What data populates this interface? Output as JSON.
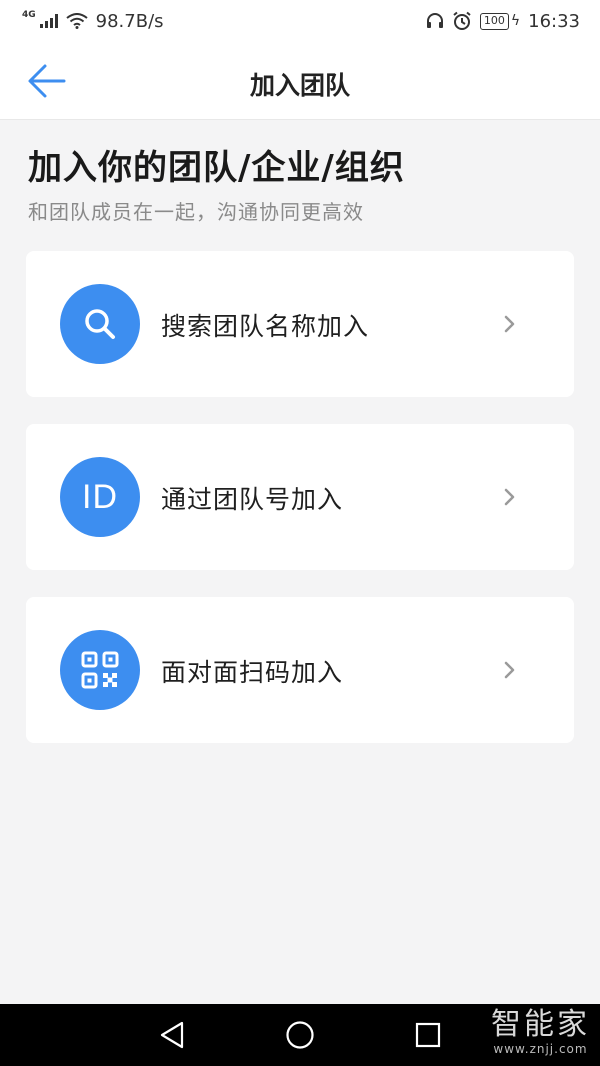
{
  "status_bar": {
    "network": "4G",
    "speed": "98.7B/s",
    "battery": "100",
    "time": "16:33"
  },
  "header": {
    "title": "加入团队",
    "back_icon": "arrow-left-icon"
  },
  "intro": {
    "heading": "加入你的团队/企业/组织",
    "subtitle": "和团队成员在一起，沟通协同更高效"
  },
  "options": [
    {
      "label": "搜索团队名称加入",
      "icon": "search-icon"
    },
    {
      "label": "通过团队号加入",
      "icon": "id-icon",
      "icon_text": "ID"
    },
    {
      "label": "面对面扫码加入",
      "icon": "qr-code-icon"
    }
  ],
  "nav": {
    "back": "triangle-back-icon",
    "home": "circle-home-icon",
    "recent": "square-recent-icon"
  },
  "watermark": {
    "main": "智能家",
    "sub": "www.znjj.com"
  },
  "colors": {
    "accent": "#3d8ef0",
    "background": "#f4f4f5",
    "card": "#ffffff"
  }
}
